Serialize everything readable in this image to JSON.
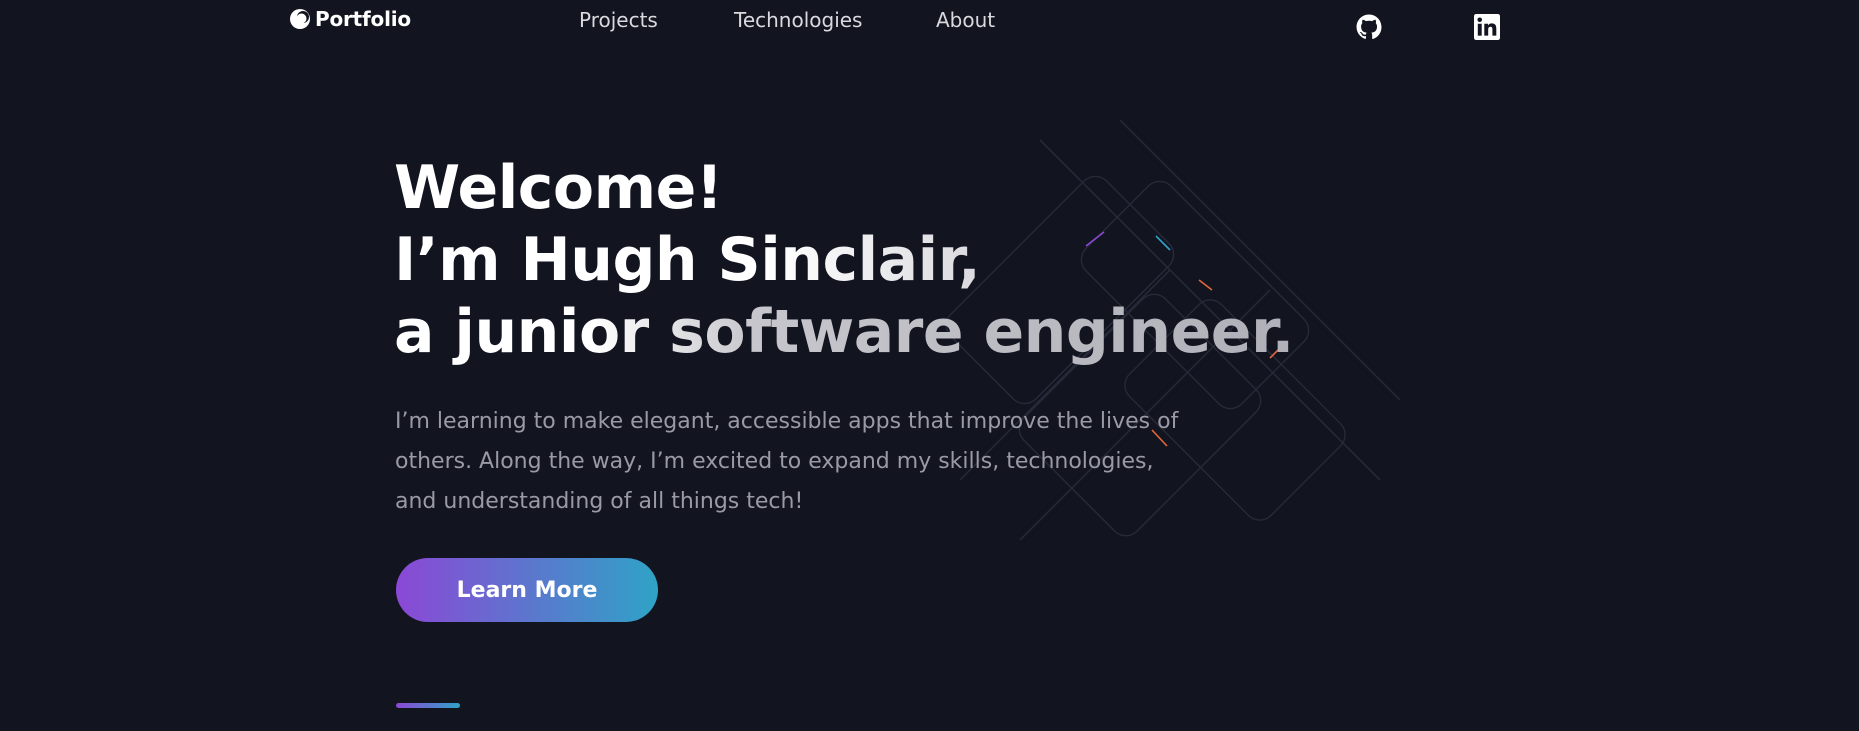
{
  "nav": {
    "logo_label": "Portfolio",
    "links": [
      {
        "label": "Projects"
      },
      {
        "label": "Technologies"
      },
      {
        "label": "About"
      }
    ],
    "social": [
      {
        "icon": "github-icon"
      },
      {
        "icon": "linkedin-icon"
      }
    ]
  },
  "hero": {
    "title_line1": "Welcome!",
    "title_line2": "I’m Hugh Sinclair,",
    "title_line3": "a junior software engineer.",
    "description": "I’m learning to make elegant, accessible apps that improve the lives of others. Along the way, I’m excited to expand my skills, technologies, and understanding of all things tech!",
    "cta_label": "Learn More"
  },
  "colors": {
    "background": "#121420",
    "accent_start": "#8b48d6",
    "accent_end": "#2fa3c6",
    "body_text": "#9a9aa6",
    "nav_text": "#d9d9de"
  }
}
